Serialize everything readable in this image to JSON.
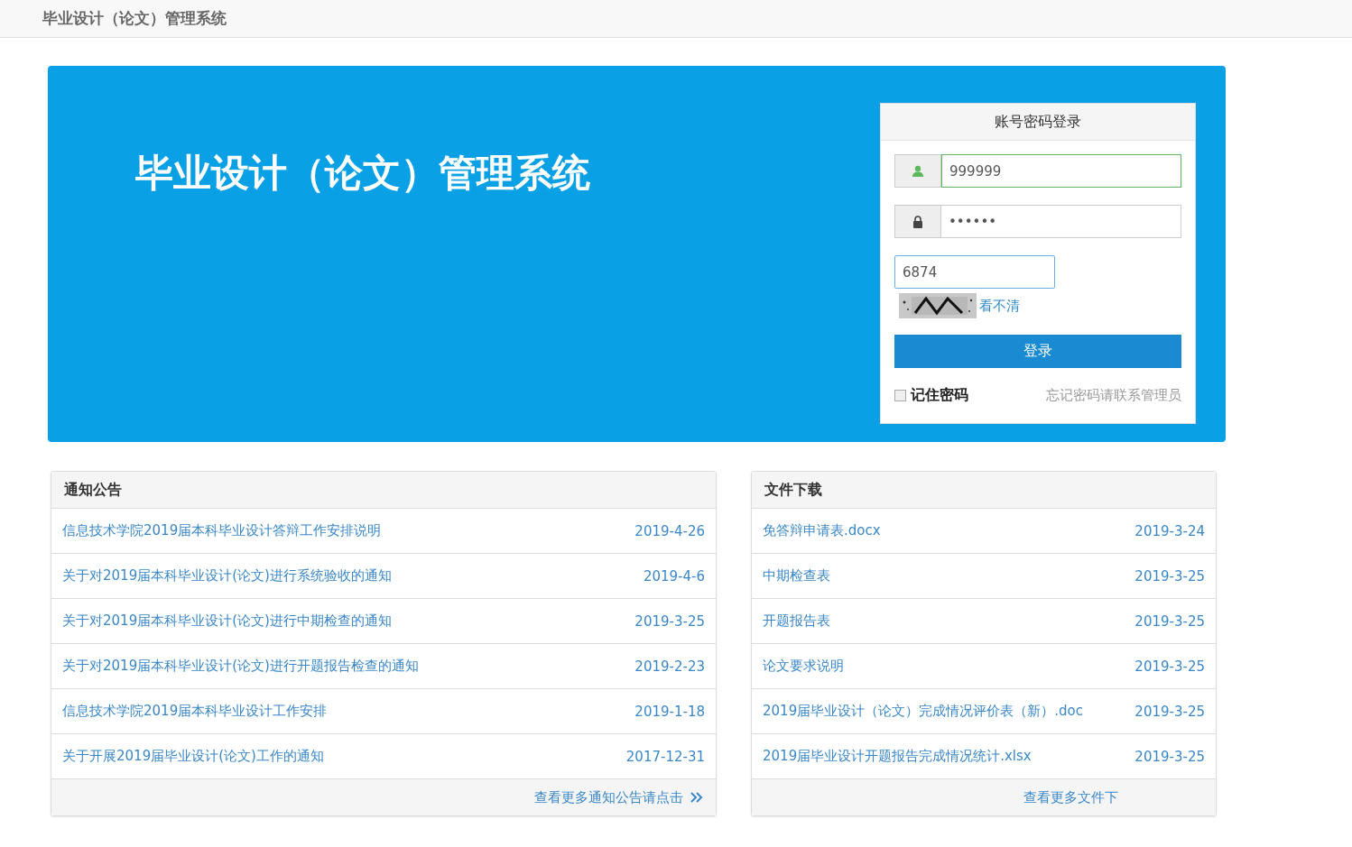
{
  "header": {
    "title": "毕业设计（论文）管理系统"
  },
  "banner": {
    "title": "毕业设计（论文）管理系统"
  },
  "login": {
    "title": "账号密码登录",
    "username": "999999",
    "password": "••••••",
    "captcha": "6874",
    "refresh_link": "看不清",
    "submit": "登录",
    "remember": {
      "label": "记住密码",
      "checked": false
    },
    "forgot": "忘记密码请联系管理员"
  },
  "panels": [
    {
      "title": "通知公告",
      "rows": [
        {
          "label": "信息技术学院2019届本科毕业设计答辩工作安排说明",
          "date": "2019-4-26"
        },
        {
          "label": "关于对2019届本科毕业设计(论文)进行系统验收的通知",
          "date": "2019-4-6"
        },
        {
          "label": "关于对2019届本科毕业设计(论文)进行中期检查的通知",
          "date": "2019-3-25"
        },
        {
          "label": "关于对2019届本科毕业设计(论文)进行开题报告检查的通知",
          "date": "2019-2-23"
        },
        {
          "label": "信息技术学院2019届本科毕业设计工作安排",
          "date": "2019-1-18"
        },
        {
          "label": "关于开展2019届毕业设计(论文)工作的通知",
          "date": "2017-12-31"
        }
      ],
      "more": {
        "label": "查看更多通知公告请点击",
        "chevron": true
      }
    },
    {
      "title": "文件下载",
      "rows": [
        {
          "label": "免答辩申请表.docx",
          "date": "2019-3-24"
        },
        {
          "label": "中期检查表",
          "date": "2019-3-25"
        },
        {
          "label": "开题报告表",
          "date": "2019-3-25"
        },
        {
          "label": "论文要求说明",
          "date": "2019-3-25"
        },
        {
          "label": "2019届毕业设计（论文）完成情况评价表（新）.doc",
          "date": "2019-3-25"
        },
        {
          "label": "2019届毕业设计开题报告完成情况统计.xlsx",
          "date": "2019-3-25"
        }
      ],
      "more": {
        "label": "查看更多文件下",
        "chevron": false
      }
    }
  ]
}
